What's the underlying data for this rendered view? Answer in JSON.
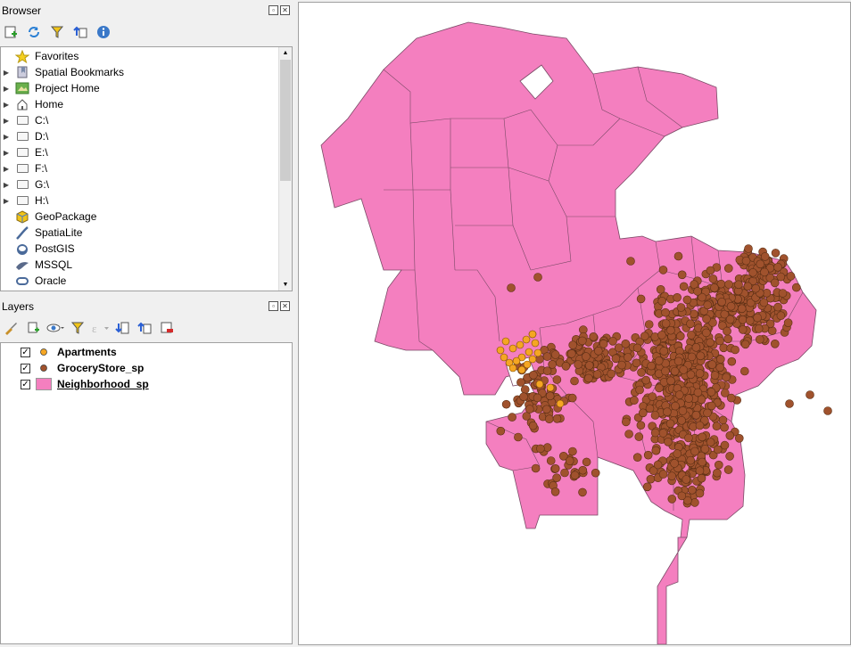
{
  "browser": {
    "title": "Browser",
    "items": [
      {
        "label": "Favorites",
        "icon": "star-icon",
        "expandable": false
      },
      {
        "label": "Spatial Bookmarks",
        "icon": "bookmark-icon",
        "expandable": true
      },
      {
        "label": "Project Home",
        "icon": "project-home-icon",
        "expandable": true
      },
      {
        "label": "Home",
        "icon": "home-icon",
        "expandable": true
      },
      {
        "label": "C:\\",
        "icon": "folder-icon",
        "expandable": true
      },
      {
        "label": "D:\\",
        "icon": "folder-icon",
        "expandable": true
      },
      {
        "label": "E:\\",
        "icon": "folder-icon",
        "expandable": true
      },
      {
        "label": "F:\\",
        "icon": "folder-icon",
        "expandable": true
      },
      {
        "label": "G:\\",
        "icon": "folder-icon",
        "expandable": true
      },
      {
        "label": "H:\\",
        "icon": "folder-icon",
        "expandable": true
      },
      {
        "label": "GeoPackage",
        "icon": "geopackage-icon",
        "expandable": false
      },
      {
        "label": "SpatiaLite",
        "icon": "spatialite-icon",
        "expandable": false
      },
      {
        "label": "PostGIS",
        "icon": "postgis-icon",
        "expandable": false
      },
      {
        "label": "MSSQL",
        "icon": "mssql-icon",
        "expandable": false
      },
      {
        "label": "Oracle",
        "icon": "oracle-icon",
        "expandable": false
      }
    ]
  },
  "layers": {
    "title": "Layers",
    "items": [
      {
        "label": "Apartments",
        "checked": true,
        "symbol": "point",
        "color": "#f5a623",
        "underline": false
      },
      {
        "label": "GroceryStore_sp",
        "checked": true,
        "symbol": "point",
        "color": "#a0522d",
        "underline": false
      },
      {
        "label": "Neighborhood_sp",
        "checked": true,
        "symbol": "polygon",
        "color": "#f47fbf",
        "underline": true
      }
    ]
  },
  "map": {
    "polygon_fill": "#f47fbf",
    "polygon_stroke": "#7a4a66",
    "grocery_color": "#a0522d",
    "apartment_color": "#f5a623"
  }
}
